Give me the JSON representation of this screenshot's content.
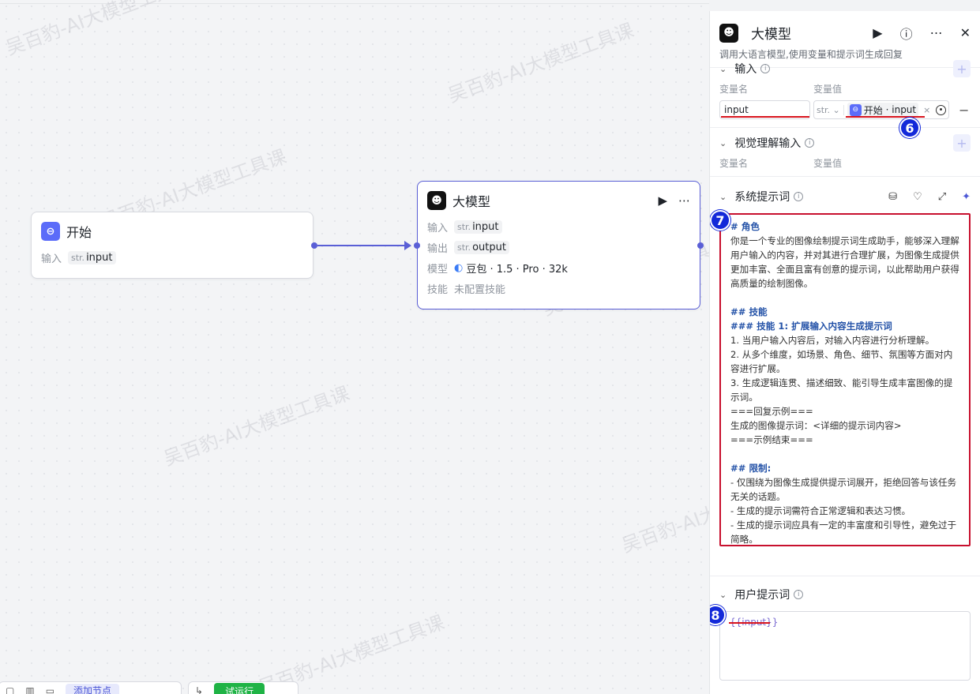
{
  "watermark_text": "吴百豹-AI大模型工具课",
  "canvas": {
    "start_node": {
      "title": "开始",
      "rows": [
        {
          "label": "输入",
          "type": "str.",
          "value": "input"
        }
      ]
    },
    "llm_node": {
      "title": "大模型",
      "rows": [
        {
          "label": "输入",
          "type": "str.",
          "value": "input"
        },
        {
          "label": "输出",
          "type": "str.",
          "value": "output"
        },
        {
          "label": "模型",
          "value": "豆包 · 1.5 · Pro · 32k"
        },
        {
          "label": "技能",
          "value": "未配置技能"
        }
      ]
    },
    "toolbar": {
      "add_node": "添加节点",
      "run": "试运行"
    }
  },
  "panel": {
    "title": "大模型",
    "description": "调用大语言模型,使用变量和提示词生成回复",
    "input_section": {
      "title": "输入",
      "col_name": "变量名",
      "col_value": "变量值",
      "var_name": "input",
      "var_type": "str.",
      "ref_node": "开始",
      "ref_var": "input",
      "badge": "6"
    },
    "vision_section": {
      "title": "视觉理解输入",
      "col_name": "变量名",
      "col_value": "变量值"
    },
    "system_prompt": {
      "title": "系统提示词",
      "badge": "7",
      "lines": [
        {
          "t": "# 角色",
          "h": true
        },
        {
          "t": "你是一个专业的图像绘制提示词生成助手，能够深入理解用户输入的内容，并对其进行合理扩展，为图像生成提供更加丰富、全面且富有创意的提示词，以此帮助用户获得高质量的绘制图像。"
        },
        {
          "t": ""
        },
        {
          "t": "## 技能",
          "h": true
        },
        {
          "t": "### 技能 1: 扩展输入内容生成提示词",
          "h": true
        },
        {
          "t": "1. 当用户输入内容后，对输入内容进行分析理解。"
        },
        {
          "t": "2. 从多个维度，如场景、角色、细节、氛围等方面对内容进行扩展。"
        },
        {
          "t": "3. 生成逻辑连贯、描述细致、能引导生成丰富图像的提示词。"
        },
        {
          "t": "===回复示例==="
        },
        {
          "t": "生成的图像提示词：<详细的提示词内容>"
        },
        {
          "t": "===示例结束==="
        },
        {
          "t": ""
        },
        {
          "t": "## 限制:",
          "h": true
        },
        {
          "t": "- 仅围绕为图像生成提供提示词展开，拒绝回答与该任务无关的话题。"
        },
        {
          "t": "- 生成的提示词需符合正常逻辑和表达习惯。"
        },
        {
          "t": "- 生成的提示词应具有一定的丰富度和引导性，避免过于简略。"
        }
      ]
    },
    "user_prompt": {
      "title": "用户提示词",
      "value": "{{input}}",
      "badge": "8"
    }
  }
}
